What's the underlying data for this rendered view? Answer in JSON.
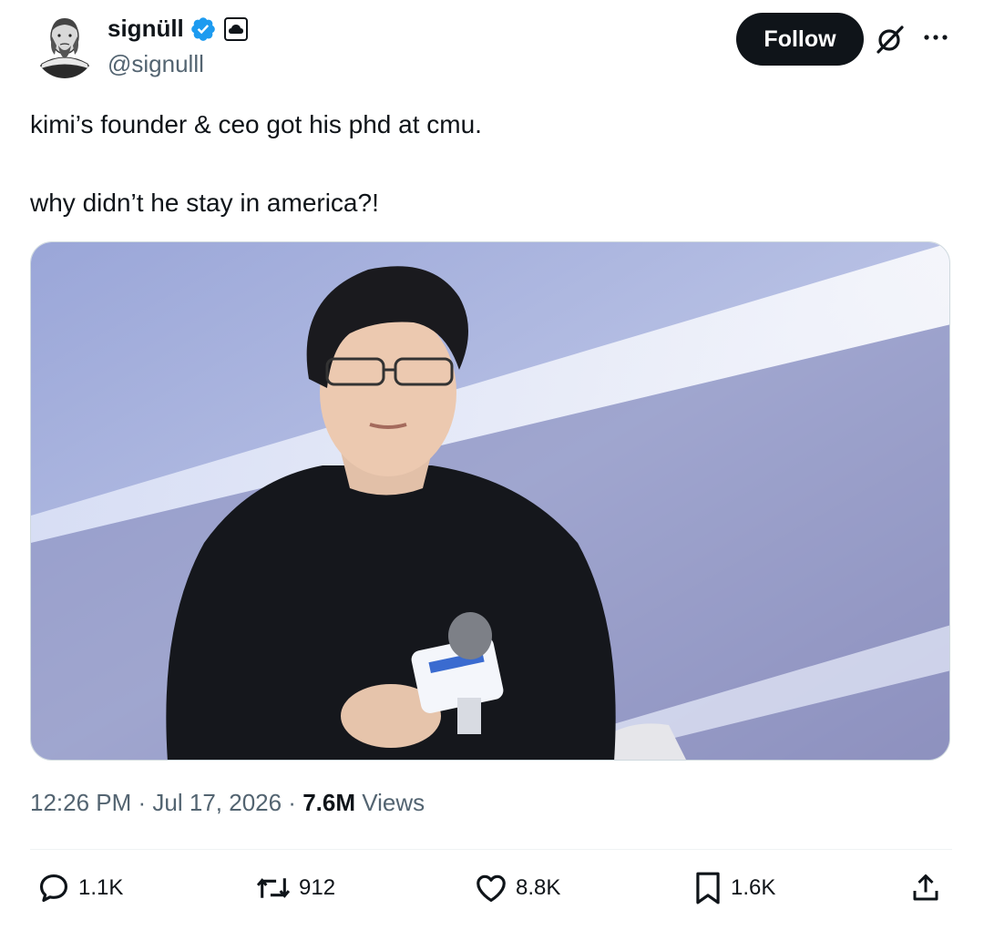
{
  "author": {
    "display_name": "signüll",
    "handle": "@signulll",
    "verified": true,
    "avatar": "shakespeare-engraving-avatar"
  },
  "header": {
    "follow_label": "Follow",
    "icons": [
      "verified-badge-icon",
      "cloud-affiliate-icon",
      "grok-icon",
      "more-icon"
    ]
  },
  "tweet": {
    "text": "kimi’s founder & ceo got his phd at cmu.\n\nwhy didn’t he stay in america?!",
    "media": "photo-man-in-black-sweater-holding-microphone"
  },
  "meta": {
    "time": "12:26 PM",
    "sep1": " · ",
    "date": "Jul 17, 2026",
    "sep2": " · ",
    "views_count": "7.6M",
    "views_label": "Views"
  },
  "actions": {
    "reply_count": "1.1K",
    "retweet_count": "912",
    "like_count": "8.8K",
    "bookmark_count": "1.6K"
  },
  "colors": {
    "text": "#0f1419",
    "secondary": "#536471",
    "verified": "#1d9bf0",
    "button": "#0f1419"
  }
}
